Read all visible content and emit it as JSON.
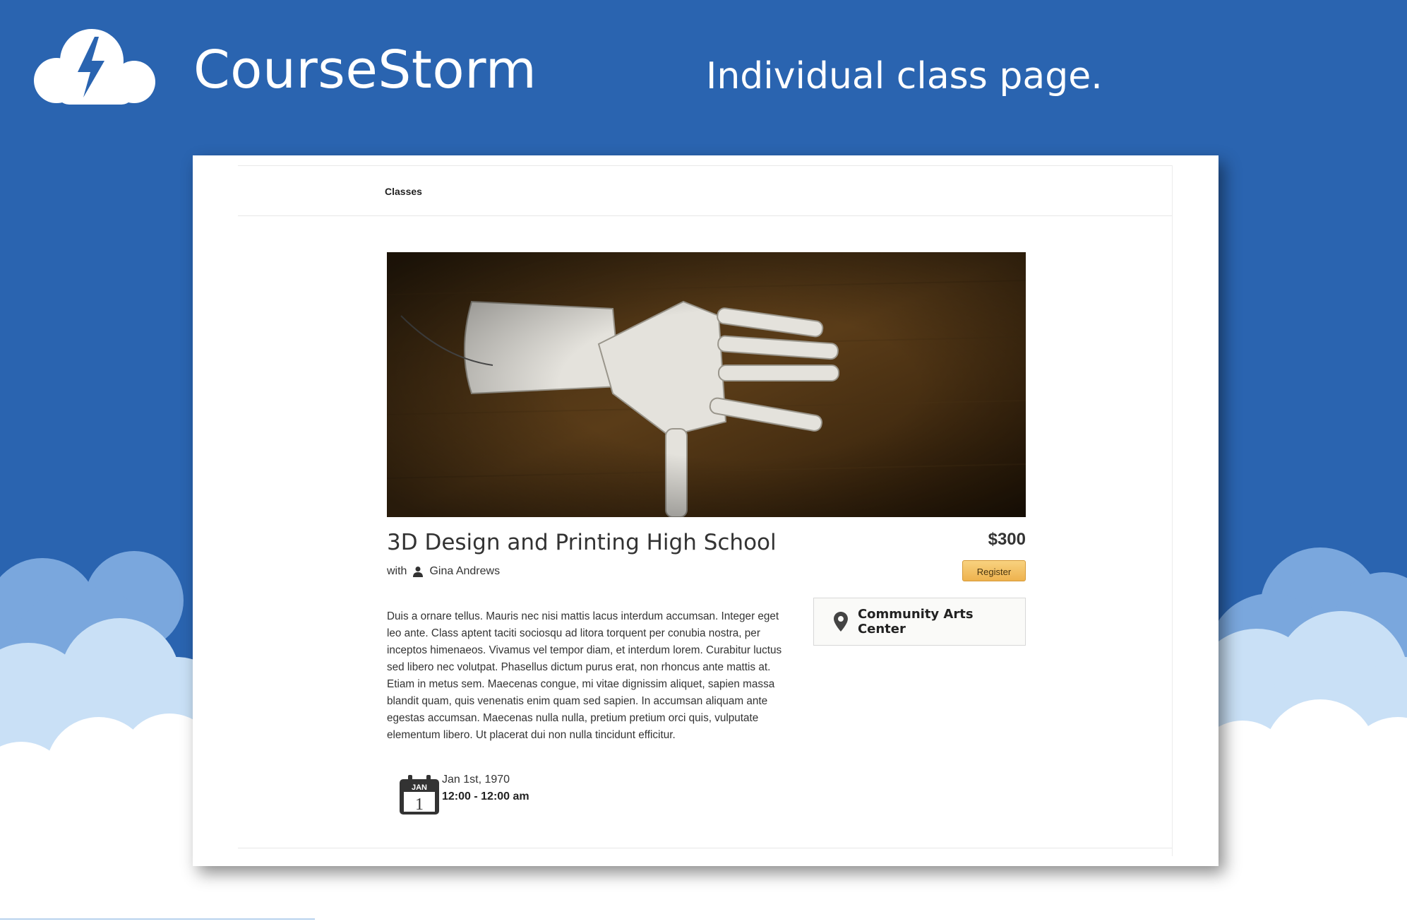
{
  "brand": {
    "name": "CourseStorm",
    "tagline": "Individual class page."
  },
  "colors": {
    "background": "#2a64b0",
    "register_button": "#f2c062",
    "cloud_light": "#c9e0f6"
  },
  "nav": {
    "classes_label": "Classes"
  },
  "course": {
    "title": "3D Design and Printing High School",
    "with_label": "with",
    "instructor": "Gina Andrews",
    "price": "$300",
    "register_label": "Register",
    "location": "Community Arts Center",
    "description": "Duis a ornare tellus. Mauris nec nisi mattis lacus interdum accumsan. Integer eget leo ante. Class aptent taciti sociosqu ad litora torquent per conubia nostra, per inceptos himenaeos. Vivamus vel tempor diam, et interdum lorem. Curabitur luctus sed libero nec volutpat. Phasellus dictum purus erat, non rhoncus ante mattis at. Etiam in metus sem. Maecenas congue, mi vitae dignissim aliquet, sapien massa blandit quam, quis venenatis enim quam sed sapien. In accumsan aliquam ante egestas accumsan. Maecenas nulla nulla, pretium pretium orci quis, vulputate elementum libero. Ut placerat dui non nulla tincidunt efficitur.",
    "calendar_month": "JAN",
    "calendar_day": "1",
    "date": "Jan 1st, 1970",
    "time": "12:00 - 12:00 am"
  },
  "icons": [
    "storm-cloud-logo-icon",
    "person-icon",
    "map-pin-icon",
    "calendar-icon"
  ]
}
